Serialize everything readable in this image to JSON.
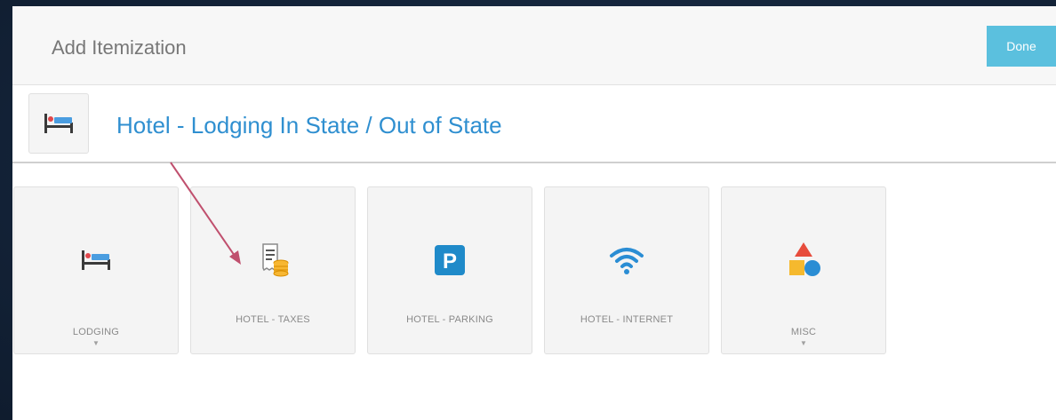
{
  "header": {
    "title": "Add Itemization",
    "done_label": "Done"
  },
  "category": {
    "icon": "bed-icon",
    "title": "Hotel - Lodging In State / Out of State"
  },
  "tiles": [
    {
      "label": "LODGING",
      "icon": "bed-icon",
      "has_dropdown": true
    },
    {
      "label": "HOTEL - TAXES",
      "icon": "receipt-coins-icon",
      "has_dropdown": false
    },
    {
      "label": "HOTEL - PARKING",
      "icon": "parking-icon",
      "has_dropdown": false
    },
    {
      "label": "HOTEL - INTERNET",
      "icon": "wifi-icon",
      "has_dropdown": false
    },
    {
      "label": "MISC",
      "icon": "shapes-icon",
      "has_dropdown": true
    }
  ],
  "colors": {
    "accent": "#2f8fd0",
    "done_button": "#5bc0de",
    "annotation_arrow": "#c0506e",
    "background": "#14243a"
  }
}
